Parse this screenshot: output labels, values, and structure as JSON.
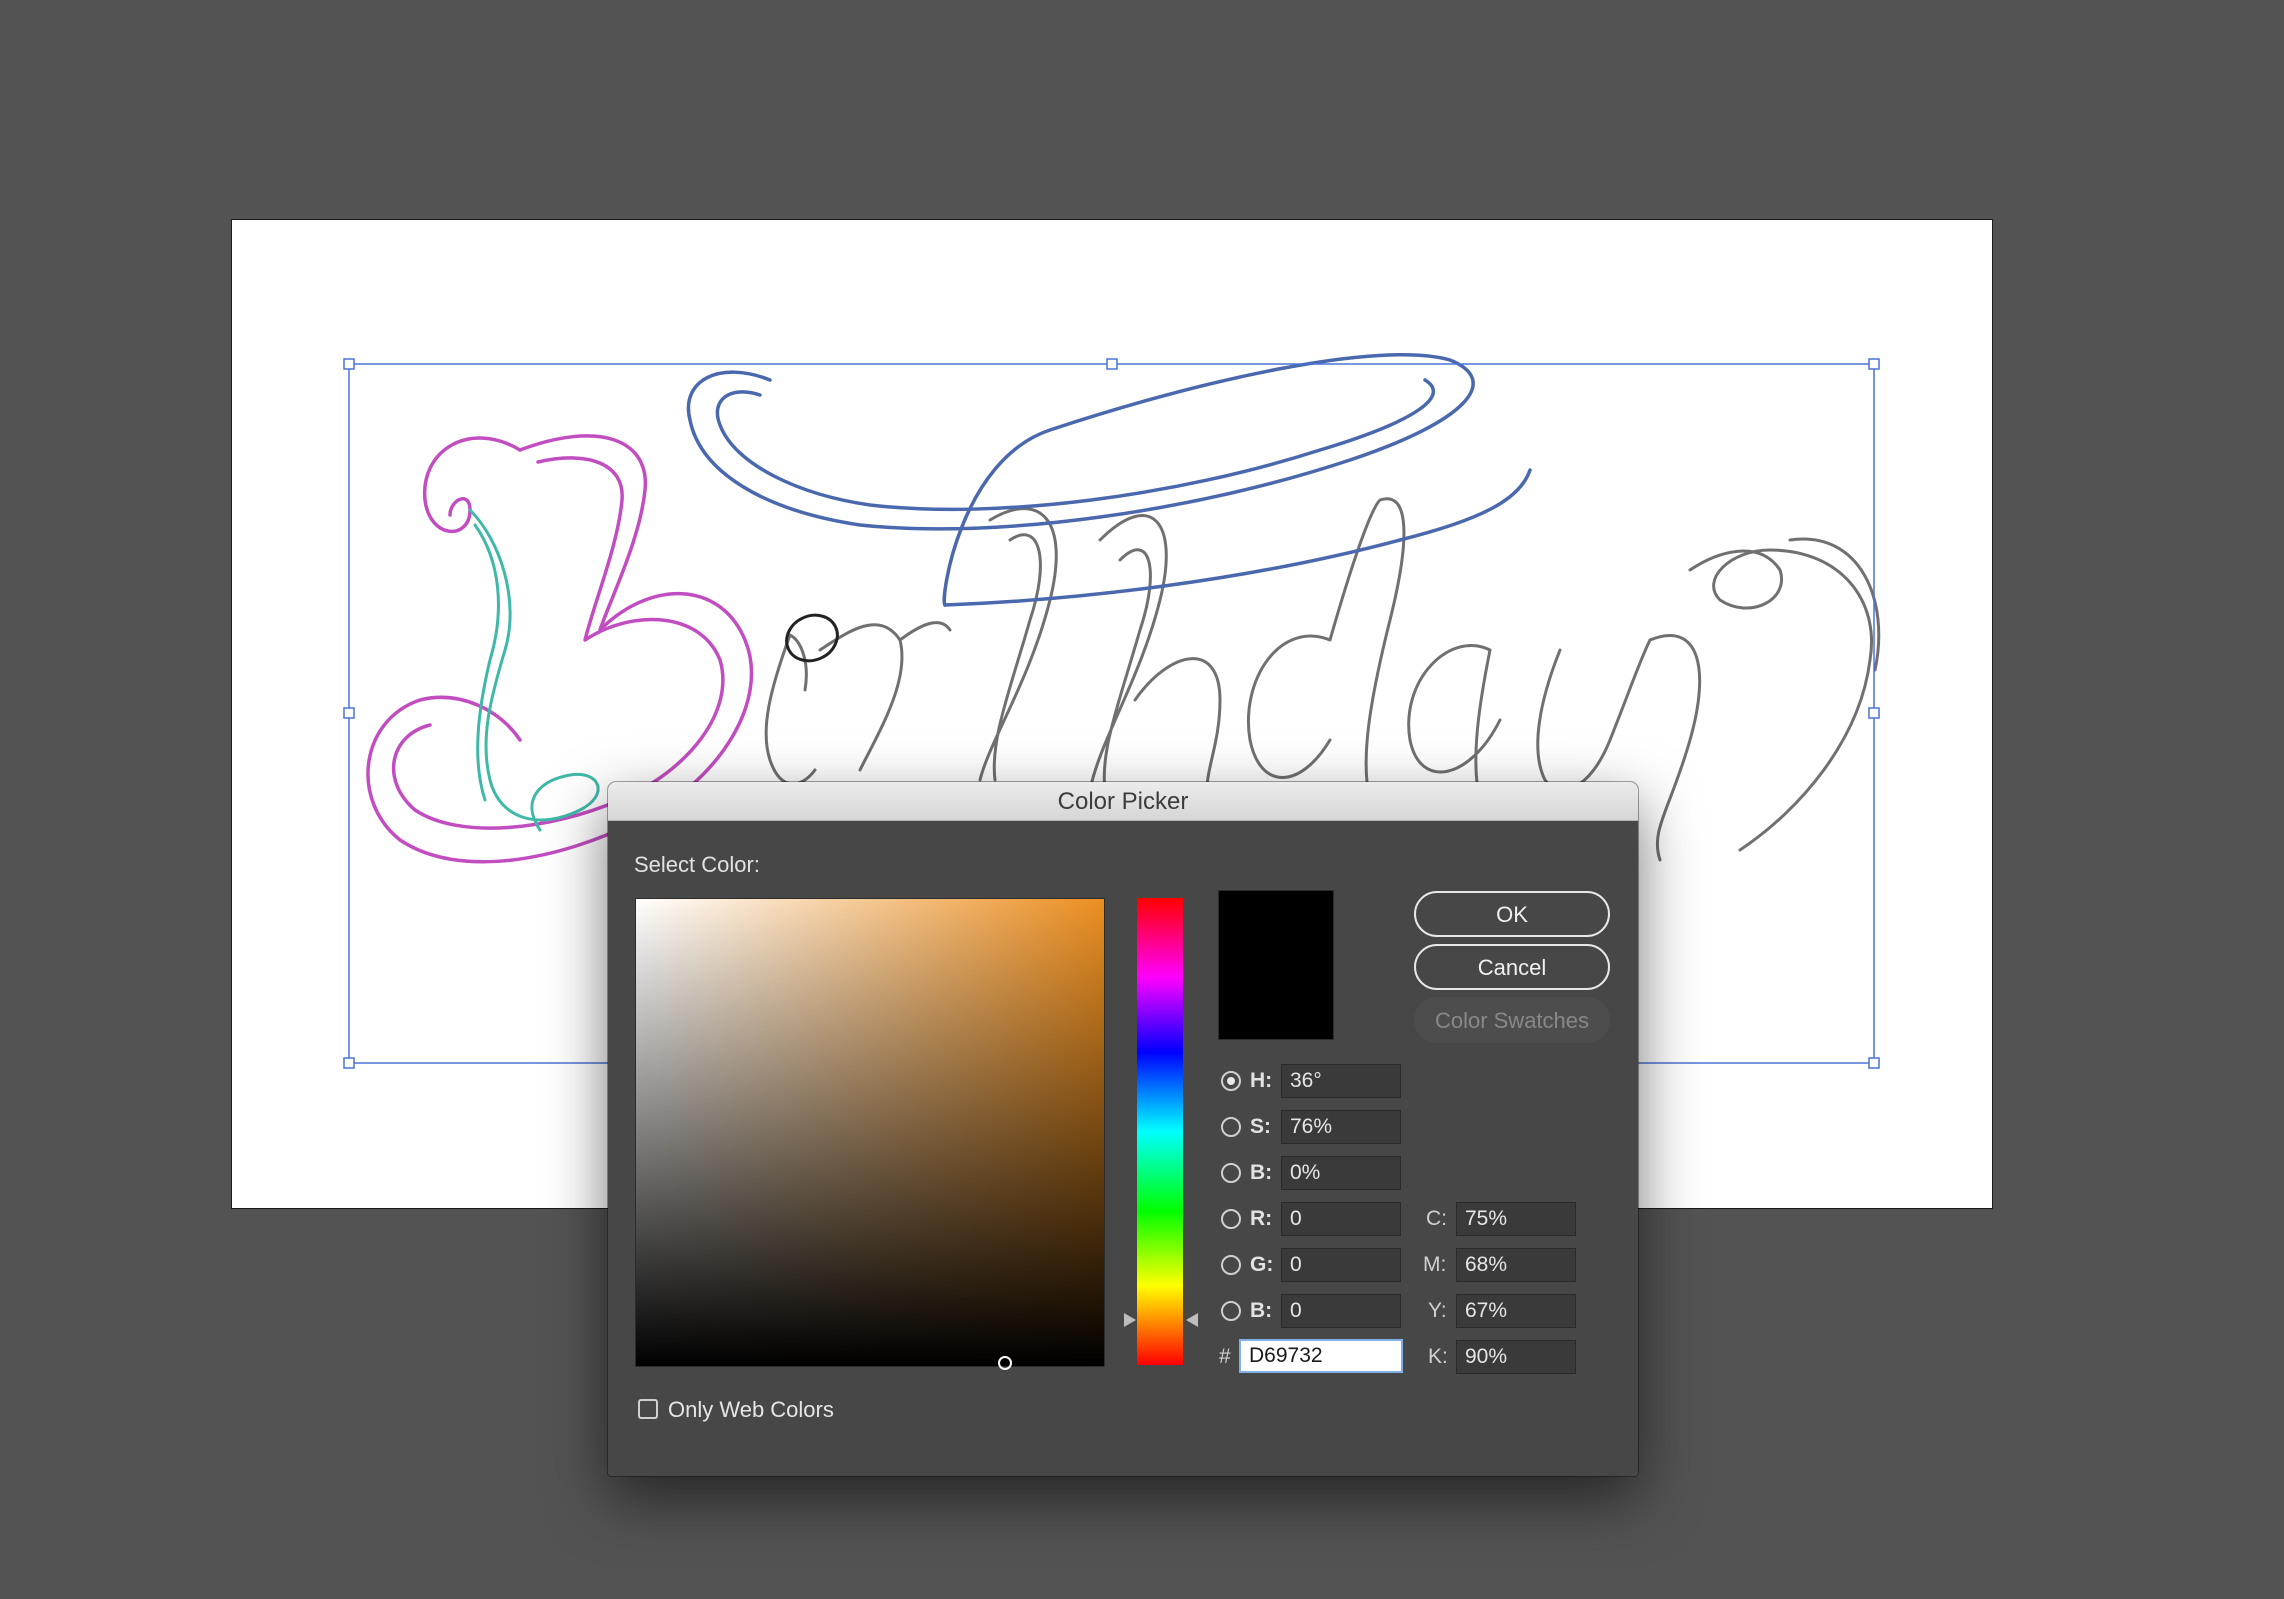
{
  "artwork": {
    "lettering_colors": {
      "b_outer": "#c24dc1",
      "b_inner": "#3fb8a8",
      "swash": "#4a68ad",
      "letters": "#707070",
      "selection": "#4a73d6"
    }
  },
  "dialog": {
    "title": "Color Picker",
    "select_label": "Select Color:",
    "base_hue_color": "#ec8f21",
    "preview_color": "#000000",
    "buttons": {
      "ok": "OK",
      "cancel": "Cancel",
      "swatches": "Color Swatches"
    },
    "hsb": {
      "h_label": "H:",
      "h_value": "36°",
      "s_label": "S:",
      "s_value": "76%",
      "b_label": "B:",
      "b_value": "0%",
      "selected": "H"
    },
    "rgb": {
      "r_label": "R:",
      "r_value": "0",
      "g_label": "G:",
      "g_value": "0",
      "b_label": "B:",
      "b_value": "0"
    },
    "hex": {
      "label": "#",
      "value": "D69732"
    },
    "cmyk": {
      "c_label": "C:",
      "c_value": "75%",
      "m_label": "M:",
      "m_value": "68%",
      "y_label": "Y:",
      "y_value": "67%",
      "k_label": "K:",
      "k_value": "90%"
    },
    "web_colors_label": "Only Web Colors",
    "web_colors_checked": false
  }
}
